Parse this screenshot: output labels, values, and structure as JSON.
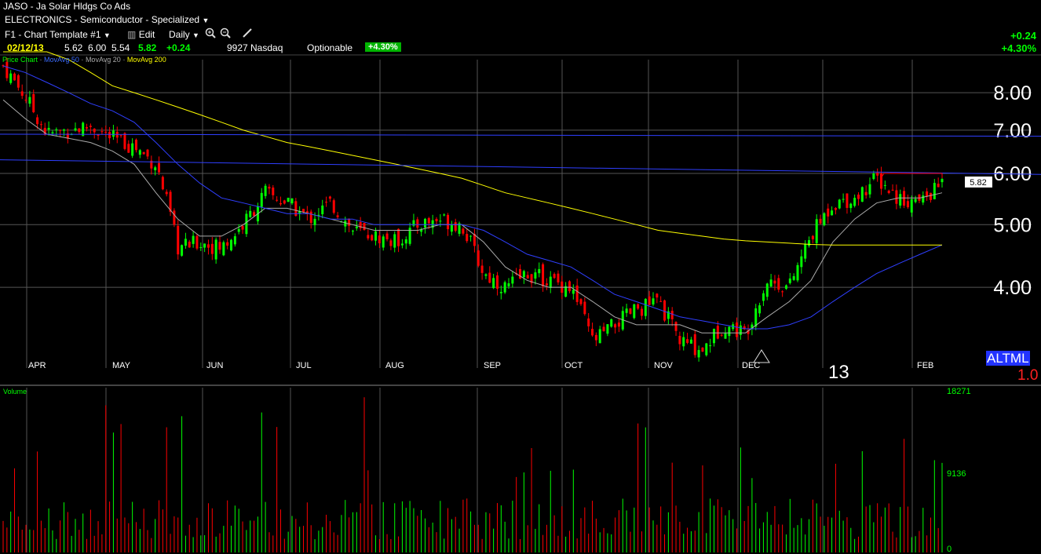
{
  "header": {
    "symbol": "JASO",
    "company": "Ja Solar Hldgs Co Ads",
    "title_sep": " - ",
    "industry": "ELECTRONICS - Semiconductor - Specialized",
    "template": "F1 - Chart Template #1",
    "edit_label": "Edit",
    "interval": "Daily",
    "date": "02/12/13",
    "open": "5.62",
    "high": "6.00",
    "low": "5.54",
    "close": "5.82",
    "change": "+0.24",
    "volume": "9927",
    "exchange": "Nasdaq",
    "optionable": "Optionable",
    "pct_change": "+4.30%",
    "right_change": "+0.24",
    "right_pct": "+4.30%"
  },
  "legend": {
    "price": "Price Chart",
    "ma50": "MovAvg 50",
    "ma20": "MovAvg 20",
    "ma200": "MovAvg 200"
  },
  "price_tag": "5.82",
  "year_label": "13",
  "bottom_right": {
    "letters": "ALTML",
    "value": "1.0"
  },
  "volume_label": "Volume",
  "icons": [
    "dropdown-caret-icon",
    "bar-chart-icon",
    "zoom-in-icon",
    "zoom-out-icon",
    "pencil-icon",
    "dividend-marker-icon"
  ],
  "colors": {
    "up": "#00ff00",
    "down": "#ff0000",
    "ma20": "#aaaaaa",
    "ma50": "#2f3fff",
    "ma200": "#ffff00",
    "trendline": "#2f3fff",
    "resistance": "#ff0000"
  },
  "chart_data": [
    {
      "type": "candlestick",
      "title": "JASO - Ja Solar Hldgs Co Ads",
      "xlabel": "",
      "ylabel": "",
      "x_ticks": [
        "APR",
        "MAY",
        "JUN",
        "JUL",
        "AUG",
        "SEP",
        "OCT",
        "NOV",
        "DEC",
        "13",
        "FEB"
      ],
      "y_ticks": [
        "4.00",
        "5.00",
        "6.00",
        "7.00",
        "8.00"
      ],
      "ylim": [
        3.0,
        9.0
      ],
      "log_scale": true,
      "grid": true,
      "legend_position": "top-left",
      "anchors": [
        {
          "month": "APR",
          "price": 8.8
        },
        {
          "month": "APR",
          "price": 7.9
        },
        {
          "month": "APR",
          "price": 6.9
        },
        {
          "month": "APR",
          "price": 7.0
        },
        {
          "month": "APR",
          "price": 7.1
        },
        {
          "month": "MAY",
          "price": 6.8
        },
        {
          "month": "MAY",
          "price": 6.6
        },
        {
          "month": "MAY",
          "price": 6.2
        },
        {
          "month": "MAY",
          "price": 4.6
        },
        {
          "month": "MAY",
          "price": 4.7
        },
        {
          "month": "JUN",
          "price": 4.6
        },
        {
          "month": "JUN",
          "price": 5.0
        },
        {
          "month": "JUN",
          "price": 5.6
        },
        {
          "month": "JUN",
          "price": 5.4
        },
        {
          "month": "JUL",
          "price": 5.1
        },
        {
          "month": "JUL",
          "price": 5.4
        },
        {
          "month": "JUL",
          "price": 4.9
        },
        {
          "month": "JUL",
          "price": 4.8
        },
        {
          "month": "AUG",
          "price": 4.7
        },
        {
          "month": "AUG",
          "price": 5.0
        },
        {
          "month": "AUG",
          "price": 5.1
        },
        {
          "month": "AUG",
          "price": 5.0
        },
        {
          "month": "SEP",
          "price": 4.2
        },
        {
          "month": "SEP",
          "price": 4.0
        },
        {
          "month": "SEP",
          "price": 4.2
        },
        {
          "month": "OCT",
          "price": 4.1
        },
        {
          "month": "OCT",
          "price": 4.0
        },
        {
          "month": "OCT",
          "price": 3.3
        },
        {
          "month": "OCT",
          "price": 3.5
        },
        {
          "month": "NOV",
          "price": 3.7
        },
        {
          "month": "NOV",
          "price": 3.8
        },
        {
          "month": "NOV",
          "price": 3.3
        },
        {
          "month": "NOV",
          "price": 3.2
        },
        {
          "month": "DEC",
          "price": 3.5
        },
        {
          "month": "DEC",
          "price": 3.4
        },
        {
          "month": "DEC",
          "price": 4.1
        },
        {
          "month": "DEC",
          "price": 4.0
        },
        {
          "month": "13",
          "price": 4.8
        },
        {
          "month": "13",
          "price": 5.4
        },
        {
          "month": "13",
          "price": 5.5
        },
        {
          "month": "13",
          "price": 5.9
        },
        {
          "month": "FEB",
          "price": 5.5
        },
        {
          "month": "FEB",
          "price": 5.4
        },
        {
          "month": "FEB",
          "price": 5.82
        }
      ],
      "moving_averages": {
        "MovAvg 20": [
          7.8,
          7.3,
          6.9,
          6.8,
          6.7,
          6.5,
          6.2,
          5.6,
          5.1,
          4.8,
          4.8,
          5.0,
          5.3,
          5.3,
          5.2,
          5.1,
          5.0,
          4.9,
          4.9,
          4.9,
          5.0,
          5.0,
          4.7,
          4.3,
          4.1,
          4.0,
          4.0,
          3.8,
          3.6,
          3.5,
          3.5,
          3.5,
          3.4,
          3.4,
          3.4,
          3.6,
          3.8,
          4.1,
          4.7,
          5.1,
          5.4,
          5.5,
          5.5,
          5.6
        ],
        "MovAvg 50": [
          8.8,
          8.6,
          8.3,
          8.0,
          7.7,
          7.5,
          7.2,
          6.7,
          6.2,
          5.8,
          5.5,
          5.4,
          5.3,
          5.2,
          5.2,
          5.1,
          5.1,
          5.0,
          5.0,
          5.0,
          5.0,
          5.0,
          4.9,
          4.7,
          4.5,
          4.4,
          4.3,
          4.1,
          3.9,
          3.8,
          3.7,
          3.6,
          3.55,
          3.5,
          3.45,
          3.45,
          3.5,
          3.6,
          3.8,
          4.0,
          4.2,
          4.35,
          4.5,
          4.65
        ],
        "MovAvg 200": [
          10.5,
          10.0,
          9.5,
          9.0,
          8.6,
          8.2,
          8.0,
          7.8,
          7.6,
          7.4,
          7.2,
          7.0,
          6.85,
          6.7,
          6.6,
          6.5,
          6.4,
          6.3,
          6.2,
          6.1,
          6.0,
          5.9,
          5.75,
          5.6,
          5.5,
          5.4,
          5.3,
          5.2,
          5.1,
          5.0,
          4.9,
          4.85,
          4.8,
          4.75,
          4.72,
          4.7,
          4.68,
          4.66,
          4.65,
          4.65,
          4.65,
          4.65,
          4.65,
          4.65
        ]
      },
      "last_price": 5.82,
      "resistance_line": 6.0
    },
    {
      "type": "bar",
      "title": "Volume",
      "y_ticks": [
        "0",
        "9136",
        "18271"
      ],
      "ylim": [
        0,
        18271
      ],
      "last_value": 9927
    }
  ]
}
